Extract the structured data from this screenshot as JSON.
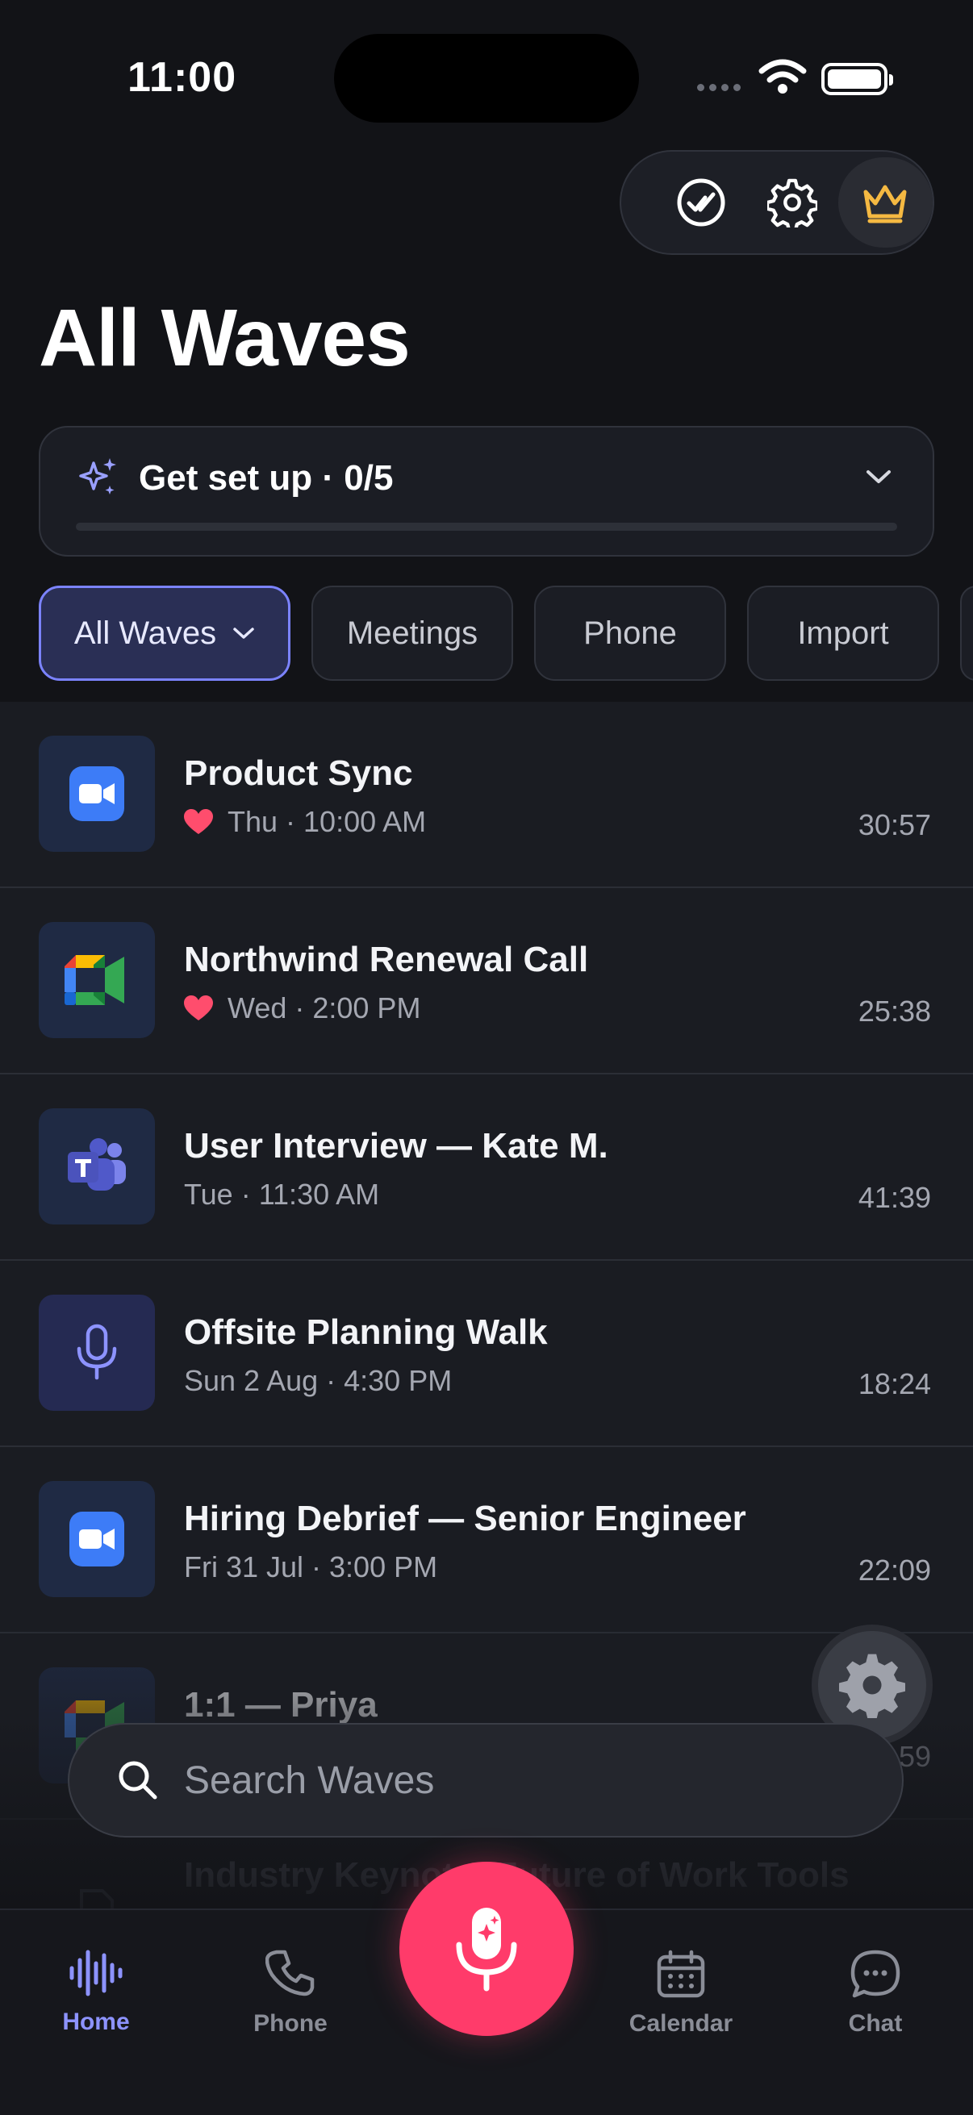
{
  "status": {
    "time": "11:00"
  },
  "title": "All Waves",
  "setup": {
    "label": "Get set up · 0/5",
    "progress": 0
  },
  "filters": [
    "All Waves",
    "Meetings",
    "Phone",
    "Import"
  ],
  "waves": [
    {
      "title": "Product Sync",
      "when": "Thu · 10:00 AM",
      "duration": "30:57",
      "source": "zoom-icon",
      "favorite": true
    },
    {
      "title": "Northwind Renewal Call",
      "when": "Wed · 2:00 PM",
      "duration": "25:38",
      "source": "google-meet-icon",
      "favorite": true
    },
    {
      "title": "User Interview — Kate M.",
      "when": "Tue · 11:30 AM",
      "duration": "41:39",
      "source": "teams-icon",
      "favorite": false
    },
    {
      "title": "Offsite Planning Walk",
      "when": "Sun 2 Aug · 4:30 PM",
      "duration": "18:24",
      "source": "microphone-icon",
      "favorite": false
    },
    {
      "title": "Hiring Debrief — Senior Engineer",
      "when": "Fri 31 Jul · 3:00 PM",
      "duration": "22:09",
      "source": "zoom-icon",
      "favorite": false
    },
    {
      "title": "1:1 — Priya",
      "when": "",
      "duration": "59",
      "source": "google-meet-icon",
      "favorite": false
    },
    {
      "title": "Industry Keynote: Future of Work Tools",
      "when": "",
      "duration": "",
      "source": "document-icon",
      "favorite": false
    }
  ],
  "search": {
    "placeholder": "Search Waves"
  },
  "tabs": [
    "Home",
    "Phone",
    "Calendar",
    "Chat"
  ],
  "colors": {
    "accent": "#7b83ff",
    "record": "#ff3b6a",
    "heart": "#ff4d6d"
  }
}
